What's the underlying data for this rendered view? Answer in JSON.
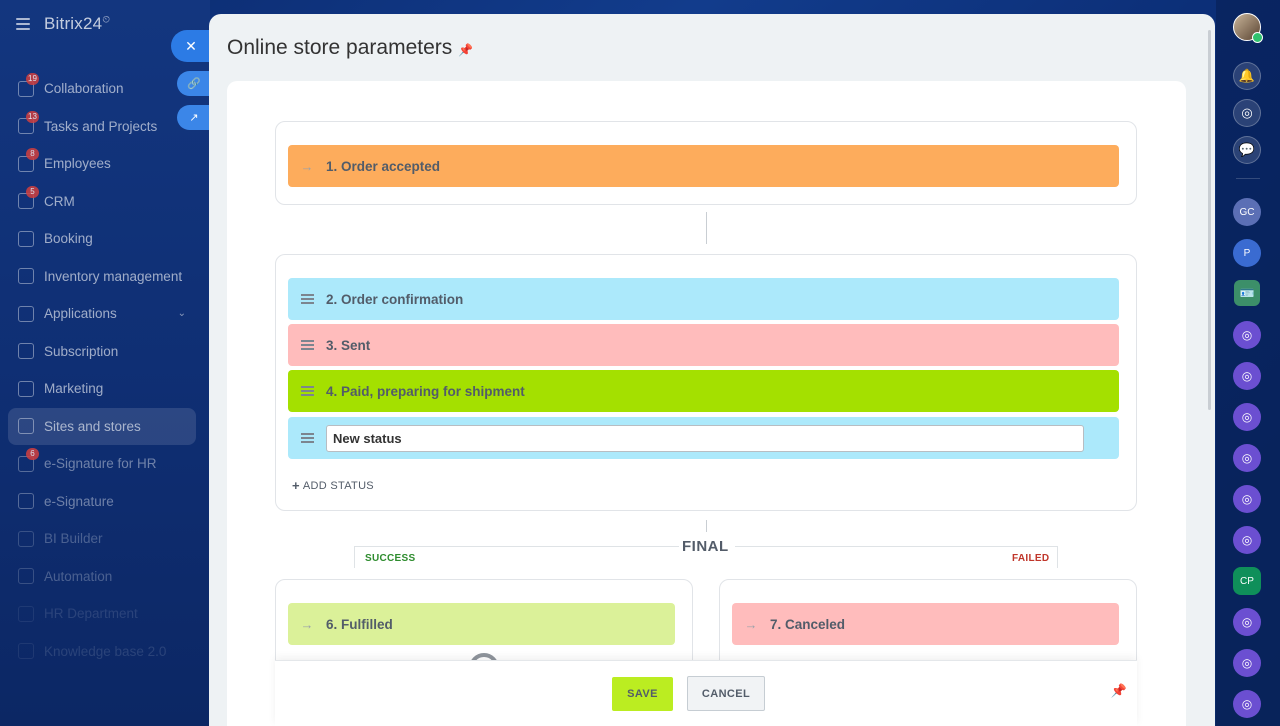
{
  "app": {
    "logo": "Bitrix24",
    "logo_clock": "⏲"
  },
  "sidebar": {
    "items": [
      {
        "label": "Collaboration",
        "badge": "19",
        "icon": "collaboration-icon"
      },
      {
        "label": "Tasks and Projects",
        "badge": "13",
        "icon": "tasks-icon"
      },
      {
        "label": "Employees",
        "badge": "8",
        "icon": "employees-icon"
      },
      {
        "label": "CRM",
        "badge": "5",
        "icon": "crm-icon"
      },
      {
        "label": "Booking",
        "badge": "",
        "icon": "booking-icon"
      },
      {
        "label": "Inventory management",
        "badge": "",
        "icon": "inventory-icon"
      },
      {
        "label": "Applications",
        "badge": "",
        "icon": "applications-icon",
        "chevron": "⌄"
      },
      {
        "label": "Subscription",
        "badge": "",
        "icon": "subscription-icon"
      },
      {
        "label": "Marketing",
        "badge": "",
        "icon": "marketing-icon"
      },
      {
        "label": "Sites and stores",
        "badge": "",
        "icon": "cart-icon"
      },
      {
        "label": "e-Signature for HR",
        "badge": "6",
        "icon": "esignature-hr-icon"
      },
      {
        "label": "e-Signature",
        "badge": "",
        "icon": "esignature-icon"
      },
      {
        "label": "BI Builder",
        "badge": "",
        "icon": "bi-builder-icon"
      },
      {
        "label": "Automation",
        "badge": "",
        "icon": "automation-icon"
      },
      {
        "label": "HR Department",
        "badge": "",
        "icon": "hr-icon"
      },
      {
        "label": "Knowledge base 2.0",
        "badge": "",
        "icon": "knowledge-icon"
      }
    ]
  },
  "side_buttons": {
    "close": "✕",
    "link": "🔗",
    "open": "↗"
  },
  "rail": {
    "gc": "GC",
    "p": "P",
    "cp": "CP",
    "bell": "🔔",
    "spiral": "◎",
    "chat": "💬",
    "card": "🪪",
    "purple": "◎"
  },
  "panel": {
    "title": "Online store parameters",
    "pin": "📌"
  },
  "statuses": {
    "arrow": "→",
    "s1": "1. Order accepted",
    "s2": "2. Order confirmation",
    "s3": "3. Sent",
    "s4": "4. Paid, preparing for shipment",
    "new_value": "New status",
    "add_status": "ADD STATUS",
    "add_plus": "+"
  },
  "final": {
    "label": "FINAL",
    "success": "SUCCESS",
    "failed": "FAILED",
    "s6": "6. Fulfilled",
    "s7": "7. Canceled"
  },
  "footer": {
    "save": "SAVE",
    "cancel": "CANCEL",
    "pin": "📌"
  },
  "colors": {
    "order_accepted": "#fdac5c",
    "order_confirmation": "#ace9fb",
    "sent": "#ffbcbc",
    "paid": "#a4e000",
    "new_status": "#ace9fb",
    "fulfilled": "#dbf199",
    "canceled": "#ffbcbc",
    "save_button": "#bbed21"
  }
}
